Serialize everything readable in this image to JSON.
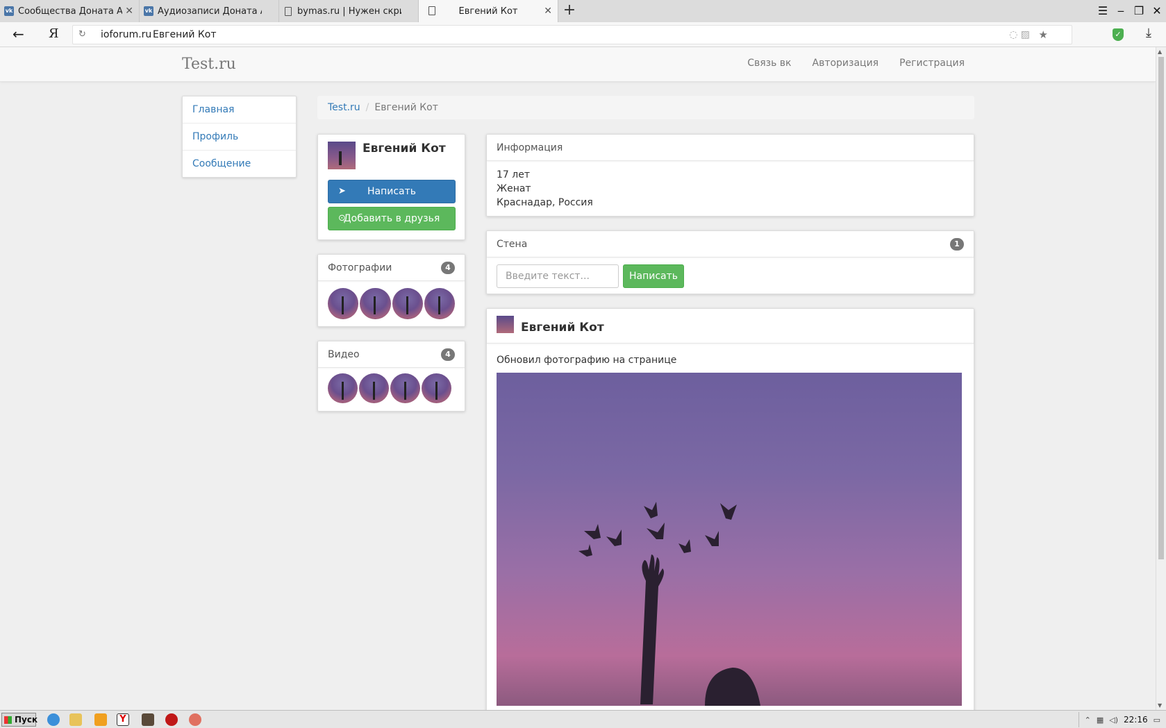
{
  "browser": {
    "tabs": [
      {
        "label": "Сообщества Доната Амо",
        "icon": "vk-icon"
      },
      {
        "label": "Аудиозаписи Доната Амона",
        "icon": "vk-icon"
      },
      {
        "label": "bymas.ru | Нужен скрин с к",
        "icon": "document-icon"
      },
      {
        "label": "Евгений Кот",
        "icon": "document-icon"
      }
    ],
    "new_tab": "+",
    "address": {
      "domain": "ioforum.ru",
      "title": "Евгений Кот"
    },
    "ya_logo": "Я"
  },
  "site": {
    "brand": "Test.ru",
    "nav": [
      "Связь вк",
      "Авторизация",
      "Регистрация"
    ]
  },
  "sidebar": {
    "items": [
      "Главная",
      "Профиль",
      "Сообщение"
    ]
  },
  "breadcrumb": {
    "root": "Test.ru",
    "current": "Евгений Кот"
  },
  "profile": {
    "name": "Евгений Кот",
    "write_button": "Написать",
    "add_friend_button": "Добавить в друзья"
  },
  "photos": {
    "title": "Фотографии",
    "count": "4"
  },
  "videos": {
    "title": "Видео",
    "count": "4"
  },
  "info": {
    "title": "Информация",
    "age": "17 лет",
    "status": "Женат",
    "location": "Краснадар, Россия"
  },
  "wall": {
    "title": "Стена",
    "count": "1",
    "input_placeholder": "Введите текст...",
    "submit": "Написать"
  },
  "post": {
    "author": "Евгений Кот",
    "text": "Обновил фотографию на странице"
  },
  "taskbar": {
    "start": "Пуск",
    "time": "22:16"
  }
}
